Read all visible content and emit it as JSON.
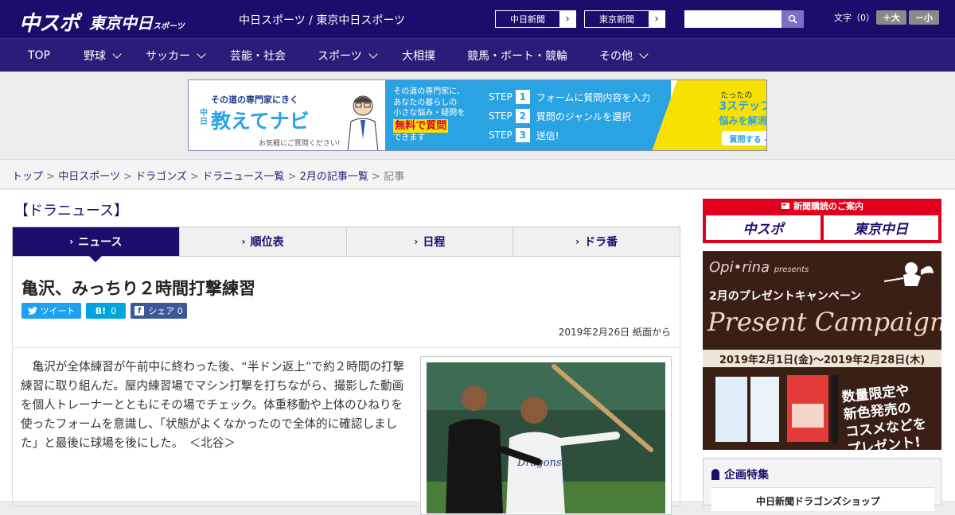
{
  "header": {
    "logo_main": "中スポ",
    "logo_sub": "東京中日",
    "logo_sub_small": "スポーツ",
    "site_link": "中日スポーツ / 東京中日スポーツ",
    "paper_buttons": [
      "中日新聞",
      "東京新聞"
    ],
    "search_placeholder": "",
    "font_label": "文字（0）",
    "font_larger": "＋大",
    "font_smaller": "－小"
  },
  "nav": {
    "items": [
      {
        "label": "TOP"
      },
      {
        "label": "野球"
      },
      {
        "label": "サッカー"
      },
      {
        "label": "芸能・社会"
      },
      {
        "label": "スポーツ"
      },
      {
        "label": "大相撲"
      },
      {
        "label": "競馬・ボート・競輪"
      },
      {
        "label": "その他"
      }
    ]
  },
  "banner": {
    "tagline": "その道の専門家にきく",
    "title_small": "中日",
    "title": "教えてナビ",
    "note": "お気軽にご質問ください!",
    "desc_line1": "その道の専門家に、",
    "desc_line2": "あなたの暮らしの",
    "desc_line3": "小さな悩み・疑問を",
    "desc_free": "無料で質問",
    "desc_end": "できます",
    "step_word": "STEP",
    "steps": [
      {
        "num": "1",
        "text": "フォームに質問内容を入力"
      },
      {
        "num": "2",
        "text": "質問のジャンルを選択"
      },
      {
        "num": "3",
        "text": "送信!"
      }
    ],
    "promo_small": "たったの",
    "promo_big": "3ステップで",
    "promo_end": "悩みを解消!",
    "promo_btn": "質問する →"
  },
  "breadcrumb": {
    "items": [
      "トップ",
      "中日スポーツ",
      "ドラゴンズ",
      "ドラニュース一覧",
      "2月の記事一覧"
    ],
    "current": "記事",
    "separator": ">"
  },
  "section": {
    "title": "【ドラニュース】"
  },
  "tabs": [
    {
      "label": "ニュース"
    },
    {
      "label": "順位表"
    },
    {
      "label": "日程"
    },
    {
      "label": "ドラ番"
    }
  ],
  "article": {
    "headline": "亀沢、みっちり２時間打撃練習",
    "share": {
      "tweet": "ツイート",
      "hatena": "B!",
      "hatena_count": "0",
      "facebook": "シェア",
      "facebook_count": "0"
    },
    "dateline": "2019年2月26日 紙面から",
    "body": "亀沢が全体練習が午前中に終わった後、“半ドン返上”で約２時間の打撃練習に取り組んだ。屋内練習場でマシン打撃を打ちながら、撮影した動画を個人トレーナーとともにその場でチェック。体重移動や上体のひねりを使ったフォームを意識し、「状態がよくなかったので全体的に確認しました」と最後に球場を後にした。　＜北谷＞"
  },
  "sidebar": {
    "subscribe_header": "新聞購読のご案内",
    "subscribe_left": "中スポ",
    "subscribe_right": "東京中日",
    "ad_brand": "Opi•rina",
    "ad_brand_small": "presents",
    "ad_campaign_jp": "2月のプレゼントキャンペーン",
    "ad_campaign_en": "Present Campaign",
    "ad_period": "2019年2月1日(金)～2019年2月28日(木)",
    "ad_limited1": "数量限定や",
    "ad_limited2": "新色発売の",
    "ad_limited3": "コスメなどを",
    "ad_limited4": "プレゼント!",
    "feature_title": "企画特集",
    "feature_item": "中日新聞ドラゴンズショップ"
  },
  "colors": {
    "header_bg": "#1b0d6b",
    "nav_bg": "#2c1c7a",
    "accent_red": "#e0001d",
    "tweet": "#1da1f2",
    "hatena": "#00a4de",
    "facebook": "#3b5998"
  }
}
